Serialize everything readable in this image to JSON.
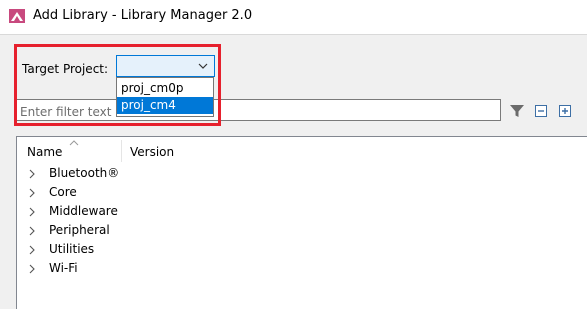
{
  "window": {
    "title": "Add Library - Library Manager 2.0"
  },
  "target_project": {
    "label": "Target Project:",
    "selected_value": "",
    "options": [
      "proj_cm0p",
      "proj_cm4"
    ],
    "highlighted_option": "proj_cm4"
  },
  "filter": {
    "placeholder": "Enter filter text"
  },
  "toolbar": {
    "icons": [
      "filter-icon",
      "collapse-all-icon",
      "expand-all-icon"
    ]
  },
  "tree": {
    "columns": [
      "Name",
      "Version"
    ],
    "rows": [
      "Bluetooth®",
      "Core",
      "Middleware",
      "Peripheral",
      "Utilities",
      "Wi-Fi"
    ]
  },
  "colors": {
    "highlight_border": "#e6202d",
    "selection": "#0078d7",
    "combo_background": "#e5f1fb"
  }
}
